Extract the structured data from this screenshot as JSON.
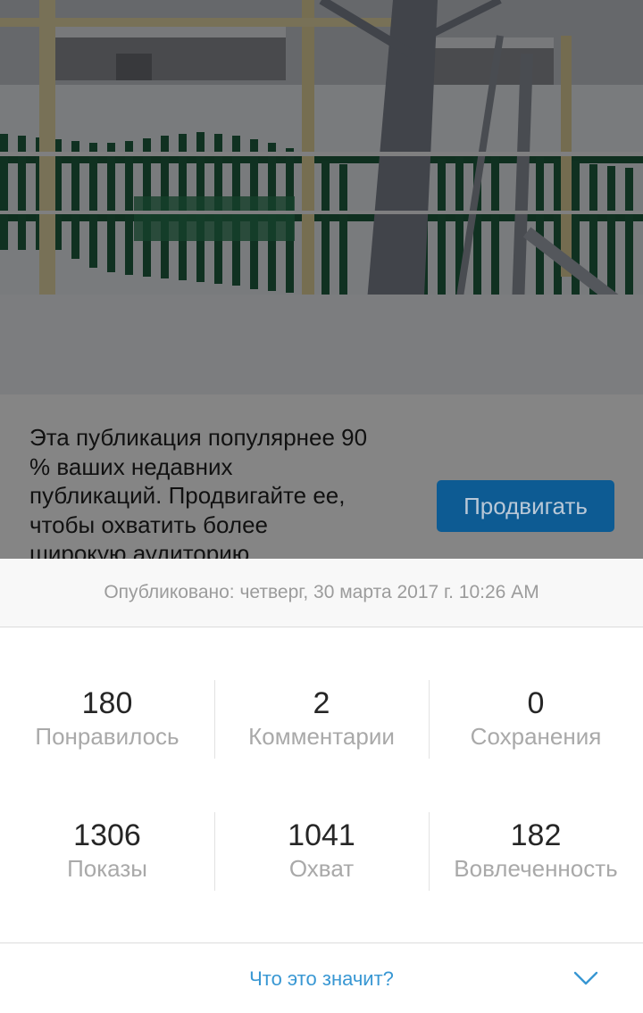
{
  "promo": {
    "text": "Эта публикация популярнее 90 % ваших недавних публикаций. Продвигайте ее, чтобы охватить более широкую аудиторию",
    "button_label": "Продвигать"
  },
  "insights": {
    "published": "Опубликовано: четверг, 30 марта 2017 г. 10:26 AM",
    "stats": [
      {
        "value": "180",
        "label": "Понравилось"
      },
      {
        "value": "2",
        "label": "Комментарии"
      },
      {
        "value": "0",
        "label": "Сохранения"
      },
      {
        "value": "1306",
        "label": "Показы"
      },
      {
        "value": "1041",
        "label": "Охват"
      },
      {
        "value": "182",
        "label": "Вовлеченность"
      }
    ],
    "help_link": "Что это значит?",
    "expand_icon": "chevron-down-icon"
  },
  "colors": {
    "accent_link": "#3897d3",
    "promote_button": "#0d5b93",
    "dim_overlay": "#858585"
  }
}
